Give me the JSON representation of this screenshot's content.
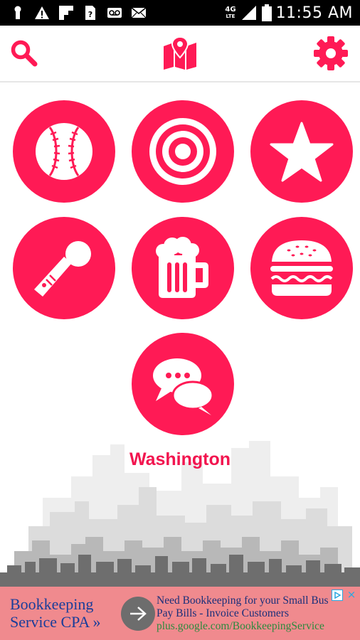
{
  "status_bar": {
    "time": "11:55 AM",
    "network": "4G",
    "network_sub": "LTE",
    "icons": [
      "keyhole-icon",
      "warning-icon",
      "flipboard-icon",
      "help-file-icon",
      "voicemail-icon",
      "mail-icon",
      "signal-icon",
      "battery-icon"
    ]
  },
  "toolbar": {
    "icons": [
      "search-icon",
      "map-icon",
      "gear-icon"
    ]
  },
  "categories": [
    {
      "name": "sports",
      "icon": "baseball-icon"
    },
    {
      "name": "target",
      "icon": "target-icon"
    },
    {
      "name": "favorites",
      "icon": "star-icon"
    },
    {
      "name": "karaoke",
      "icon": "microphone-icon"
    },
    {
      "name": "bars",
      "icon": "beer-mug-icon"
    },
    {
      "name": "food",
      "icon": "burger-icon"
    },
    {
      "name": "chat",
      "icon": "chat-bubbles-icon"
    }
  ],
  "city": {
    "name": "Washington"
  },
  "ad": {
    "title_line1": "Bookkeeping",
    "title_line2": "Service CPA »",
    "line1": "Need Bookkeeping for your Small Bus",
    "line2": "Pay Bills - Invoice Customers",
    "url": "plus.google.com/BookkeepingService",
    "close": "×"
  },
  "colors": {
    "accent": "#ff1a55",
    "city_text": "#f2154f",
    "ad_background": "#f08a8e",
    "ad_title": "#1a3d9a",
    "ad_url": "#2b8a3e",
    "status_bar": "#000000"
  }
}
